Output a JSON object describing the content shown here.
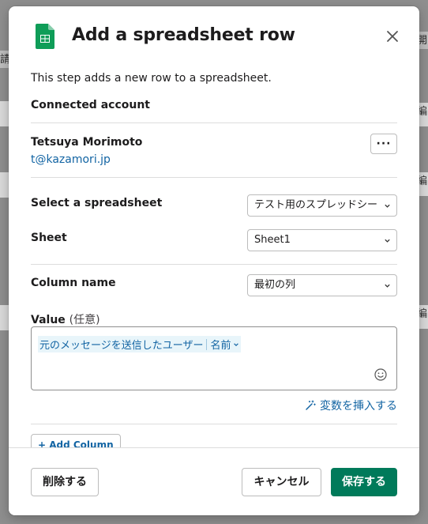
{
  "background": {
    "fragments": [
      "開",
      "請",
      "編",
      "編",
      "編",
      "編"
    ]
  },
  "modal": {
    "title": "Add a spreadsheet row",
    "icon": "google-sheets-icon",
    "description": "This step adds a new row to a spreadsheet.",
    "connected_account": {
      "label": "Connected account",
      "name": "Tetsuya Morimoto",
      "email": "t@kazamori.jp",
      "more_label": "···"
    },
    "spreadsheet": {
      "label": "Select a spreadsheet",
      "value": "テスト用のスプレッドシー"
    },
    "sheet": {
      "label": "Sheet",
      "value": "Sheet1"
    },
    "column": {
      "label": "Column name",
      "value": "最初の列"
    },
    "value_field": {
      "label": "Value",
      "optional": "(任意)",
      "token_main": "元のメッセージを送信したユーザー",
      "token_sub": "名前"
    },
    "insert_variable": "変数を挿入する",
    "add_column": "+ Add Column"
  },
  "footer": {
    "delete": "削除する",
    "cancel": "キャンセル",
    "save": "保存する"
  },
  "colors": {
    "accent_green": "#007a5a",
    "link_blue": "#1264a3",
    "sheets_green": "#0f9d58"
  }
}
